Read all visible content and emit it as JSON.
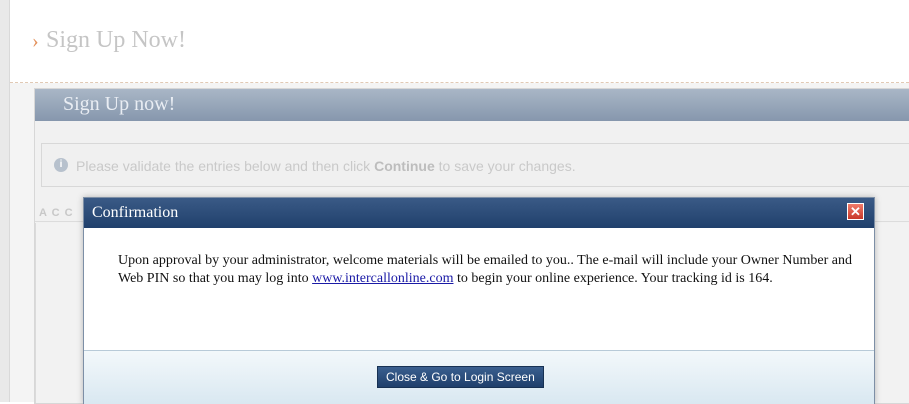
{
  "page": {
    "header_title": "Sign Up Now!",
    "panel_title": "Sign Up now!",
    "info_prefix": "Please validate the entries below and then click ",
    "info_bold": "Continue",
    "info_suffix": " to save your changes.",
    "section_label": "A C C"
  },
  "modal": {
    "title": "Confirmation",
    "close_icon": "close-icon",
    "body_part1": "Upon approval by your administrator, welcome materials will be emailed to you.. The e-mail will include your Owner Number and Web PIN so that you may log into ",
    "link_text": "www.intercallonline.com",
    "body_part2": " to begin your online experience. Your tracking id is 164.",
    "button_label": "Close & Go to Login Screen"
  },
  "colors": {
    "modal_header": "#20406c",
    "close_button": "#c8382a",
    "accent_chevron": "#e3915c"
  }
}
